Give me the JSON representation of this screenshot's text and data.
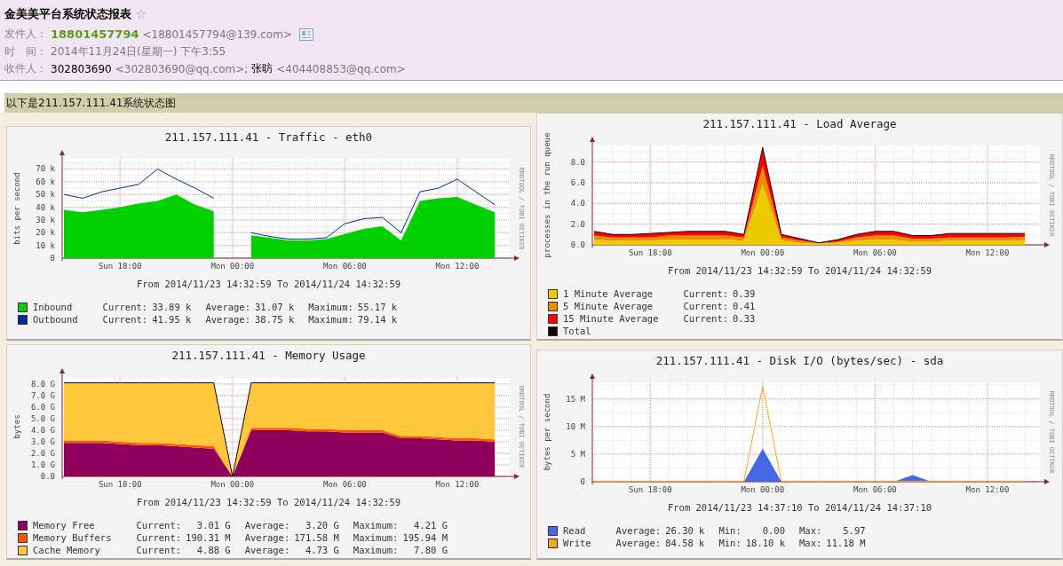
{
  "email": {
    "subject": "金美美平台系统状态报表",
    "star": "☆",
    "from": {
      "label": "发件人：",
      "name": "18801457794",
      "address": "<18801457794@139.com>"
    },
    "time": {
      "label": "时　间：",
      "value": "2014年11月24日(星期一) 下午3:55"
    },
    "to": {
      "label": "收件人：",
      "recipients": [
        {
          "name": "302803690",
          "address": "<302803690@qq.com>;"
        },
        {
          "name": "张昉",
          "address": "<404408853@qq.com>"
        }
      ]
    }
  },
  "banner": "以下是211.157.111.41系统状态图",
  "graphs": [
    {
      "credit": "RRDTOOL / TOBI OETIKER",
      "range": "From 2014/11/23 14:32:59 To 2014/11/24 14:32:59",
      "chart_data": {
        "type": "area",
        "title": "211.157.111.41 - Traffic - eth0",
        "ylabel": "bits per second",
        "stacked": false,
        "grid": true,
        "categories": [
          null,
          null,
          null,
          "Sun 18:00",
          null,
          null,
          null,
          null,
          null,
          "Mon 00:00",
          null,
          null,
          null,
          null,
          null,
          "Mon 06:00",
          null,
          null,
          null,
          null,
          null,
          "Mon 12:00",
          null,
          null
        ],
        "ylim": [
          0,
          78
        ],
        "yticks": [
          {
            "value": 0,
            "label": "0"
          },
          {
            "value": 10,
            "label": "10 k"
          },
          {
            "value": 20,
            "label": "20 k"
          },
          {
            "value": 30,
            "label": "30 k"
          },
          {
            "value": 40,
            "label": "40 k"
          },
          {
            "value": 50,
            "label": "50 k"
          },
          {
            "value": 60,
            "label": "60 k"
          },
          {
            "value": 70,
            "label": "70 k"
          }
        ],
        "series": [
          {
            "name": "Inbound",
            "color": "#00cf00",
            "values": [
              38,
              36,
              38,
              40,
              43,
              45,
              50,
              42,
              37,
              null,
              18,
              16,
              14,
              14,
              15,
              19,
              23,
              25,
              14,
              45,
              47,
              48,
              42,
              36
            ]
          },
          {
            "name": "Outbound",
            "type": "line",
            "color": "#002a97",
            "values": [
              50,
              47,
              52,
              55,
              58,
              70,
              62,
              55,
              47,
              null,
              20,
              17,
              15,
              15,
              16,
              27,
              31,
              32,
              20,
              52,
              55,
              62,
              52,
              42
            ]
          }
        ]
      },
      "legend": [
        {
          "stats": [
            "Current:",
            "33.89 k",
            "Average:",
            "31.07 k",
            "Maximum:",
            "55.17 k"
          ]
        },
        {
          "stats": [
            "Current:",
            "41.95 k",
            "Average:",
            "38.75 k",
            "Maximum:",
            "79.14 k"
          ]
        }
      ]
    },
    {
      "credit": "RRDTOOL / TOBI OETIKER",
      "range": "From 2014/11/23 14:32:59 To 2014/11/24 14:32:59",
      "chart_data": {
        "type": "area",
        "title": "211.157.111.41 - Load Average",
        "ylabel": "processes in the run queue",
        "stacked": true,
        "grid": true,
        "categories": [
          null,
          null,
          null,
          "Sun 18:00",
          null,
          null,
          null,
          null,
          null,
          "Mon 00:00",
          null,
          null,
          null,
          null,
          null,
          "Mon 06:00",
          null,
          null,
          null,
          null,
          null,
          "Mon 12:00",
          null,
          null
        ],
        "ylim": [
          0,
          9.6
        ],
        "yticks": [
          {
            "value": 0,
            "label": "0.0"
          },
          {
            "value": 2,
            "label": "2.0"
          },
          {
            "value": 4,
            "label": "4.0"
          },
          {
            "value": 6,
            "label": "6.0"
          },
          {
            "value": 8,
            "label": "8.0"
          }
        ],
        "series": [
          {
            "name": "1 Minute Average",
            "color": "#eacc00",
            "values": [
              0.5,
              0.4,
              0.4,
              0.4,
              0.5,
              0.5,
              0.5,
              0.5,
              0.4,
              5.8,
              0.4,
              0.2,
              0.1,
              0.2,
              0.4,
              0.5,
              0.5,
              0.3,
              0.3,
              0.4,
              0.4,
              0.4,
              0.4,
              0.4
            ]
          },
          {
            "name": "5 Minute Average",
            "color": "#ea8f00",
            "values": [
              0.4,
              0.3,
              0.3,
              0.3,
              0.4,
              0.4,
              0.4,
              0.4,
              0.3,
              1.8,
              0.3,
              0.2,
              0.1,
              0.1,
              0.3,
              0.4,
              0.4,
              0.3,
              0.3,
              0.3,
              0.3,
              0.3,
              0.3,
              0.4
            ]
          },
          {
            "name": "15 Minute Average",
            "color": "#ff0000",
            "values": [
              0.4,
              0.3,
              0.3,
              0.4,
              0.3,
              0.4,
              0.4,
              0.4,
              0.3,
              1.8,
              0.3,
              0.2,
              0.0,
              0.2,
              0.3,
              0.4,
              0.4,
              0.3,
              0.3,
              0.4,
              0.4,
              0.4,
              0.4,
              0.3
            ]
          }
        ]
      },
      "legend": [
        {
          "stats": [
            "Current:",
            "0.39"
          ]
        },
        {
          "stats": [
            "Current:",
            "0.41"
          ]
        },
        {
          "stats": [
            "Current:",
            "0.33"
          ]
        },
        {
          "label": "Total",
          "color": "#1a0000"
        }
      ]
    },
    {
      "credit": "RRDTOOL / TOBI OETIKER",
      "range": "From 2014/11/23 14:32:59 To 2014/11/24 14:32:59",
      "chart_data": {
        "type": "area",
        "title": "211.157.111.41 - Memory Usage",
        "ylabel": "bytes",
        "stacked": true,
        "grid": true,
        "categories": [
          null,
          null,
          null,
          "Sun 18:00",
          null,
          null,
          null,
          null,
          null,
          "Mon 00:00",
          null,
          null,
          null,
          null,
          null,
          "Mon 06:00",
          null,
          null,
          null,
          null,
          null,
          "Mon 12:00",
          null,
          null
        ],
        "ylim": [
          0,
          8.6
        ],
        "yticks": [
          {
            "value": 0,
            "label": "0.0"
          },
          {
            "value": 1,
            "label": "1.0 G"
          },
          {
            "value": 2,
            "label": "2.0 G"
          },
          {
            "value": 3,
            "label": "3.0 G"
          },
          {
            "value": 4,
            "label": "4.0 G"
          },
          {
            "value": 5,
            "label": "5.0 G"
          },
          {
            "value": 6,
            "label": "6.0 G"
          },
          {
            "value": 7,
            "label": "7.0 G"
          },
          {
            "value": 8,
            "label": "8.0 G"
          }
        ],
        "series": [
          {
            "name": "Memory Free",
            "color": "#8f005c",
            "values": [
              2.9,
              2.9,
              2.9,
              2.8,
              2.7,
              2.7,
              2.6,
              2.5,
              2.4,
              0,
              4.0,
              4.0,
              4.0,
              3.9,
              3.9,
              3.8,
              3.8,
              3.8,
              3.3,
              3.3,
              3.2,
              3.1,
              3.1,
              3.0
            ]
          },
          {
            "name": "Memory Buffers",
            "color": "#ff5700",
            "values": [
              0.2,
              0.2,
              0.2,
              0.2,
              0.2,
              0.2,
              0.2,
              0.2,
              0.2,
              0,
              0.2,
              0.2,
              0.2,
              0.2,
              0.2,
              0.2,
              0.2,
              0.2,
              0.2,
              0.2,
              0.2,
              0.2,
              0.2,
              0.2
            ]
          },
          {
            "name": "Cache Memory",
            "color": "#ffc73b",
            "values": [
              5.0,
              5.0,
              5.0,
              5.1,
              5.2,
              5.2,
              5.3,
              5.4,
              5.5,
              0,
              3.9,
              3.9,
              3.9,
              4.0,
              4.0,
              4.1,
              4.1,
              4.1,
              4.6,
              4.6,
              4.7,
              4.8,
              4.8,
              4.9
            ]
          }
        ]
      },
      "legend": [
        {
          "stats": [
            "Current:",
            "3.01 G",
            "Average:",
            "3.20 G",
            "Maximum:",
            "4.21 G"
          ]
        },
        {
          "stats": [
            "Current:",
            "190.31 M",
            "Average:",
            "171.58 M",
            "Maximum:",
            "195.94 M"
          ]
        },
        {
          "stats": [
            "Current:",
            "4.88 G",
            "Average:",
            "4.73 G",
            "Maximum:",
            "7.80 G"
          ]
        }
      ]
    },
    {
      "credit": "RRDTOOL / TOBI OETIKER",
      "range": "From 2014/11/23 14:37:10 To 2014/11/24 14:37:10",
      "chart_data": {
        "type": "area",
        "title": "211.157.111.41 - Disk I/O (bytes/sec) - sda",
        "ylabel": "bytes per second",
        "stacked": false,
        "grid": true,
        "categories": [
          null,
          null,
          null,
          "Sun 18:00",
          null,
          null,
          null,
          null,
          null,
          "Mon 00:00",
          null,
          null,
          null,
          null,
          null,
          "Mon 06:00",
          null,
          null,
          null,
          null,
          null,
          "Mon 12:00",
          null,
          null
        ],
        "ylim": [
          0,
          18
        ],
        "yticks": [
          {
            "value": 0,
            "label": "0"
          },
          {
            "value": 5,
            "label": "5 M"
          },
          {
            "value": 10,
            "label": "10 M"
          },
          {
            "value": 15,
            "label": "15 M"
          }
        ],
        "series": [
          {
            "name": "Read",
            "color": "#4668e4",
            "values": [
              0,
              0,
              0,
              0,
              0,
              0,
              0,
              0,
              0,
              6,
              0,
              0,
              0,
              0,
              0,
              0,
              0,
              1.2,
              0,
              0,
              0,
              0,
              0,
              0
            ]
          },
          {
            "name": "Write",
            "type": "line",
            "color": "#f9a41f",
            "values": [
              0.1,
              0.1,
              0.1,
              0.1,
              0.1,
              0.1,
              0.1,
              0.1,
              0.1,
              17.3,
              0.1,
              0.1,
              0.1,
              0.1,
              0.1,
              0.1,
              0.1,
              0.1,
              0.1,
              0.1,
              0.1,
              0.1,
              0.1,
              0.1
            ]
          }
        ]
      },
      "legend": [
        {
          "stats": [
            "Average:",
            "26.30 k",
            "Min:",
            "0.00",
            "Max:",
            "5.97"
          ]
        },
        {
          "stats": [
            "Average:",
            "84.58 k",
            "Min:",
            "18.10 k",
            "Max:",
            "11.18 M"
          ]
        }
      ]
    }
  ]
}
